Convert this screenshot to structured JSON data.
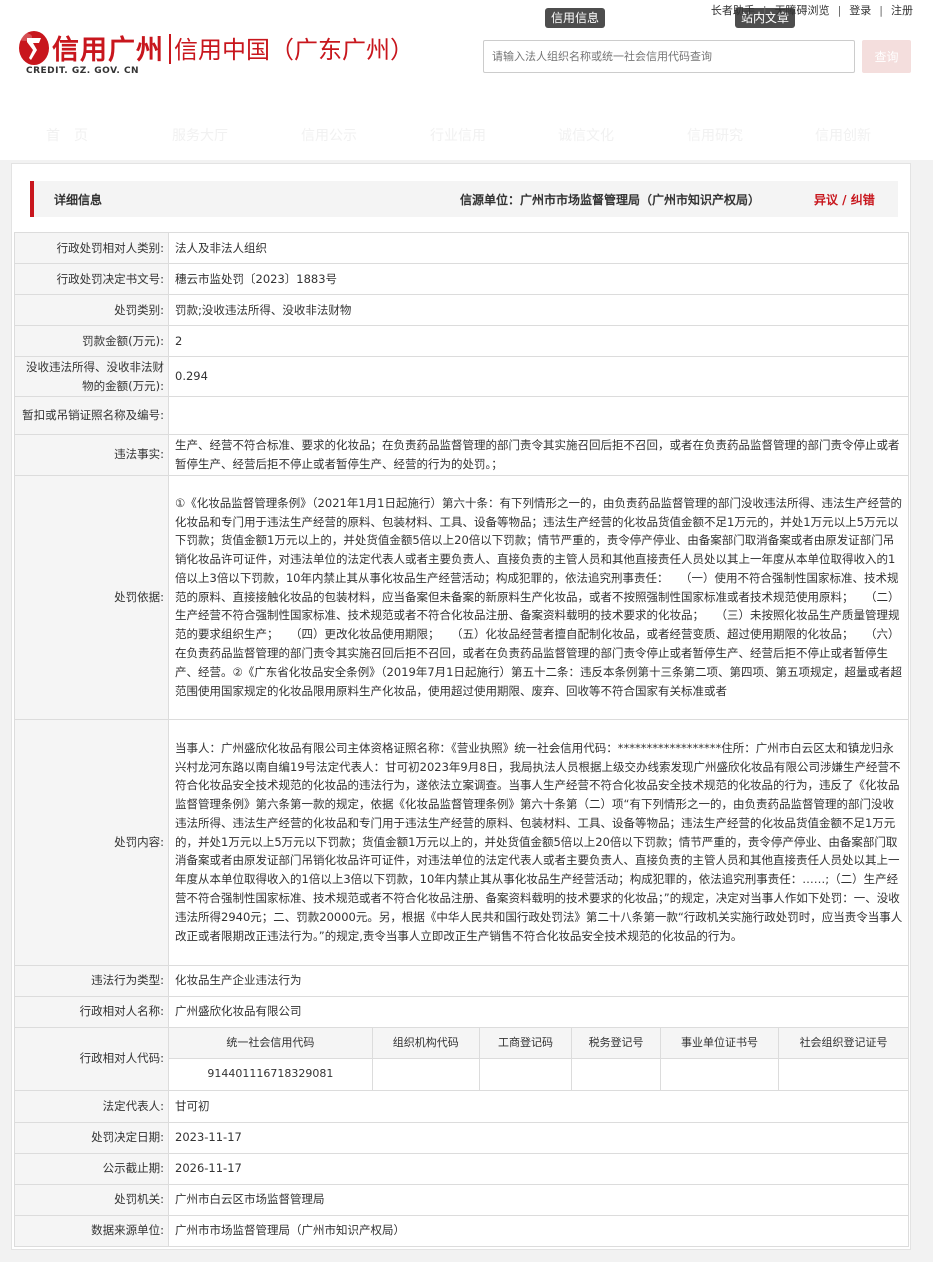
{
  "header": {
    "logo_name": "信用广州",
    "logo_sub": "信用中国（广东广州）",
    "logo_domain": "CREDIT. GZ. GOV. CN",
    "tab_credit_info": "信用信息",
    "tab_site_article": "站内文章",
    "top_links": [
      "长者助手",
      "无障碍浏览",
      "登录",
      "注册"
    ],
    "search_placeholder": "请输入法人组织名称或统一社会信用代码查询",
    "search_button": "查询",
    "nav": [
      "首　页",
      "服务大厅",
      "信用公示",
      "行业信用",
      "诚信文化",
      "信用研究",
      "信用创新"
    ]
  },
  "panel": {
    "title": "详细信息",
    "source": "信源单位：广州市市场监督管理局（广州市知识产权局）",
    "objection": "异议 / 纠错"
  },
  "rows": {
    "r1": {
      "label": "行政处罚相对人类别:",
      "value": "法人及非法人组织"
    },
    "r2": {
      "label": "行政处罚决定书文号:",
      "value": "穗云市监处罚〔2023〕1883号"
    },
    "r3": {
      "label": "处罚类别:",
      "value": "罚款;没收违法所得、没收非法财物"
    },
    "r4": {
      "label": "罚款金额(万元):",
      "value": "2"
    },
    "r5": {
      "label": "没收违法所得、没收非法财物的金额(万元):",
      "value": "0.294"
    },
    "r6": {
      "label": "暂扣或吊销证照名称及编号:",
      "value": ""
    },
    "r7": {
      "label": "违法事实:",
      "value": "生产、经营不符合标准、要求的化妆品；在负责药品监督管理的部门责令其实施召回后拒不召回，或者在负责药品监督管理的部门责令停止或者暂停生产、经营后拒不停止或者暂停生产、经营的行为的处罚。；"
    },
    "r8": {
      "label": "处罚依据:",
      "value": "①《化妆品监督管理条例》（2021年1月1日起施行）第六十条：有下列情形之一的，由负责药品监督管理的部门没收违法所得、违法生产经营的化妆品和专门用于违法生产经营的原料、包装材料、工具、设备等物品；违法生产经营的化妆品货值金额不足1万元的，并处1万元以上5万元以下罚款；货值金额1万元以上的，并处货值金额5倍以上20倍以下罚款；情节严重的，责令停产停业、由备案部门取消备案或者由原发证部门吊销化妆品许可证件，对违法单位的法定代表人或者主要负责人、直接负责的主管人员和其他直接责任人员处以其上一年度从本单位取得收入的1倍以上3倍以下罚款，10年内禁止其从事化妆品生产经营活动；构成犯罪的，依法追究刑事责任：　　（一）使用不符合强制性国家标准、技术规范的原料、直接接触化妆品的包装材料，应当备案但未备案的新原料生产化妆品，或者不按照强制性国家标准或者技术规范使用原料；　　（二）生产经营不符合强制性国家标准、技术规范或者不符合化妆品注册、备案资料载明的技术要求的化妆品；　　（三）未按照化妆品生产质量管理规范的要求组织生产；　　（四）更改化妆品使用期限；　　（五）化妆品经营者擅自配制化妆品，或者经营变质、超过使用期限的化妆品；　　（六）在负责药品监督管理的部门责令其实施召回后拒不召回，或者在负责药品监督管理的部门责令停止或者暂停生产、经营后拒不停止或者暂停生产、经营。②《广东省化妆品安全条例》（2019年7月1日起施行）第五十二条：违反本条例第十三条第二项、第四项、第五项规定，超量或者超范围使用国家规定的化妆品限用原料生产化妆品，使用超过使用期限、废弃、回收等不符合国家有关标准或者"
    },
    "r9": {
      "label": "处罚内容:",
      "value": "当事人：广州盛欣化妆品有限公司主体资格证照名称：《营业执照》统一社会信用代码：******************住所：广州市白云区太和镇龙归永兴村龙河东路以南自编19号法定代表人：甘可初2023年9月8日，我局执法人员根据上级交办线索发现广州盛欣化妆品有限公司涉嫌生产经营不符合化妆品安全技术规范的化妆品的违法行为，遂依法立案调查。当事人生产经营不符合化妆品安全技术规范的化妆品的行为，违反了《化妆品监督管理条例》第六条第一款的规定，依据《化妆品监督管理条例》第六十条第（二）项“有下列情形之一的，由负责药品监督管理的部门没收违法所得、违法生产经营的化妆品和专门用于违法生产经营的原料、包装材料、工具、设备等物品；违法生产经营的化妆品货值金额不足1万元的，并处1万元以上5万元以下罚款；货值金额1万元以上的，并处货值金额5倍以上20倍以下罚款；情节严重的，责令停产停业、由备案部门取消备案或者由原发证部门吊销化妆品许可证件，对违法单位的法定代表人或者主要负责人、直接负责的主管人员和其他直接责任人员处以其上一年度从本单位取得收入的1倍以上3倍以下罚款，10年内禁止其从事化妆品生产经营活动；构成犯罪的，依法追究刑事责任：……;（二）生产经营不符合强制性国家标准、技术规范或者不符合化妆品注册、备案资料载明的技术要求的化妆品；”的规定，决定对当事人作如下处罚：一、没收违法所得2940元；二、罚款20000元。另，根据《中华人民共和国行政处罚法》第二十八条第一款“行政机关实施行政处罚时，应当责令当事人改正或者限期改正违法行为。”的规定,责令当事人立即改正生产销售不符合化妆品安全技术规范的化妆品的行为。"
    },
    "r10": {
      "label": "违法行为类型:",
      "value": "化妆品生产企业违法行为"
    },
    "r11": {
      "label": "行政相对人名称:",
      "value": "广州盛欣化妆品有限公司"
    },
    "r12": {
      "label": "行政相对人代码:"
    },
    "r13": {
      "label": "法定代表人:",
      "value": "甘可初"
    },
    "r14": {
      "label": "处罚决定日期:",
      "value": "2023-11-17"
    },
    "r15": {
      "label": "公示截止期:",
      "value": "2026-11-17"
    },
    "r16": {
      "label": "处罚机关:",
      "value": "广州市白云区市场监督管理局"
    },
    "r17": {
      "label": "数据来源单位:",
      "value": "广州市市场监督管理局（广州市知识产权局）"
    }
  },
  "codes": {
    "headers": [
      "统一社会信用代码",
      "组织机构代码",
      "工商登记码",
      "税务登记号",
      "事业单位证书号",
      "社会组织登记证号"
    ],
    "values": [
      "914401116718329081",
      "",
      "",
      "",
      "",
      ""
    ]
  },
  "colors": {
    "brand_red": "#c8161d",
    "label_bg": "#f5f5f5"
  }
}
